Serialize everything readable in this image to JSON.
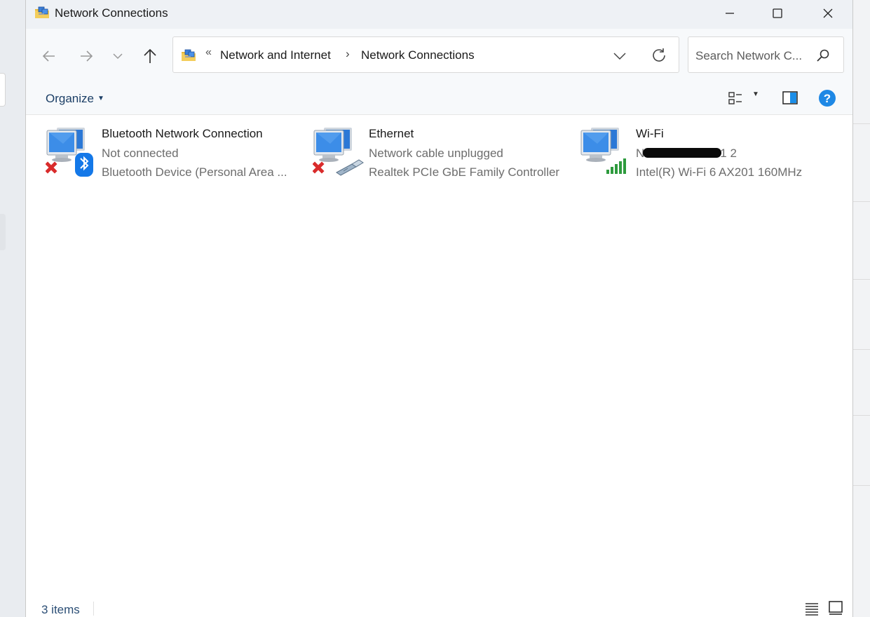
{
  "window": {
    "title": "Network Connections"
  },
  "navigation": {
    "breadcrumb_overflow": "«",
    "breadcrumbs": [
      "Network and Internet",
      "Network Connections"
    ],
    "breadcrumb_separator": "›",
    "search_placeholder": "Search Network C..."
  },
  "toolbar": {
    "organize_label": "Organize"
  },
  "connections": [
    {
      "name": "Bluetooth Network Connection",
      "status": "Not connected",
      "device": "Bluetooth Device (Personal Area ...",
      "badge": "bluetooth-icon",
      "error": true
    },
    {
      "name": "Ethernet",
      "status": "Network cable unplugged",
      "device": "Realtek PCIe GbE Family Controller",
      "badge": "ethernet-cable-icon",
      "error": true
    },
    {
      "name": "Wi-Fi",
      "status_prefix": "N",
      "status_suffix": "1 2",
      "device": "Intel(R) Wi-Fi 6 AX201 160MHz",
      "badge": "wifi-signal-icon",
      "error": false
    }
  ],
  "statusbar": {
    "item_count": "3 items"
  },
  "colors": {
    "accent": "#0067c0",
    "link_text": "#1c3f66",
    "error_red": "#d92b2b",
    "signal_green": "#2e9b3e"
  }
}
